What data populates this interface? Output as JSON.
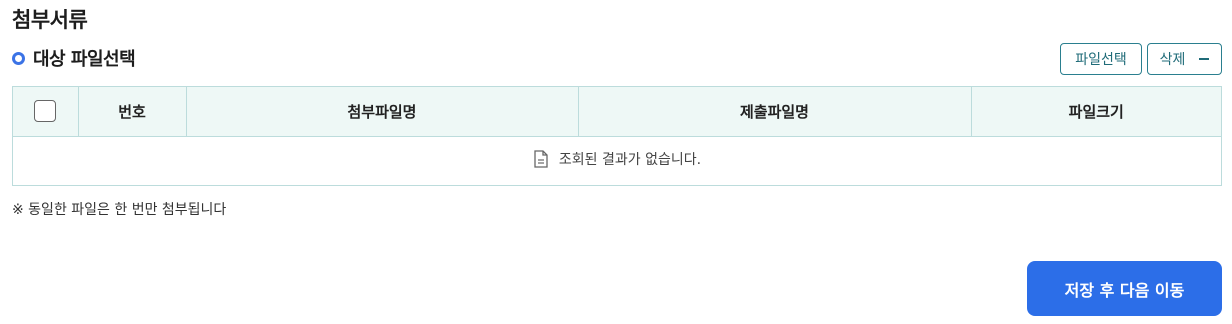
{
  "page": {
    "title": "첨부서류"
  },
  "section": {
    "title": "대상 파일선택"
  },
  "toolbar": {
    "select_label": "파일선택",
    "delete_label": "삭제"
  },
  "table": {
    "headers": [
      "번호",
      "첨부파일명",
      "제출파일명",
      "파일크기"
    ],
    "empty_message": "조회된 결과가 없습니다."
  },
  "notice": "※ 동일한 파일은 한 번만 첨부됩니다",
  "actions": {
    "primary_label": "저장 후 다음 이동"
  },
  "colors": {
    "accent": "#2c6ee8",
    "teal": "#2a7f8f",
    "header_bg": "#eef8f6",
    "border": "#bcdcdc"
  },
  "icons": {
    "bullet": "ring-bullet-icon",
    "delete": "minus-icon",
    "empty": "document-icon"
  }
}
